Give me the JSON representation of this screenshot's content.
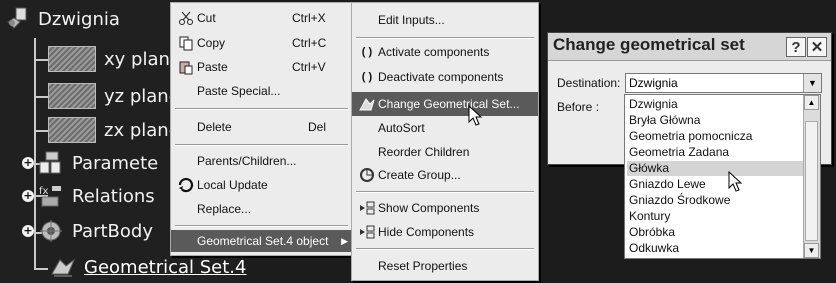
{
  "tree": {
    "root": "Dzwignia",
    "items": [
      {
        "label": "xy plane",
        "icon": "plane-icon"
      },
      {
        "label": "yz plane",
        "icon": "plane-icon"
      },
      {
        "label": "zx plane",
        "icon": "plane-icon"
      },
      {
        "label": "Paramete",
        "icon": "parameters-icon"
      },
      {
        "label": "Relations",
        "icon": "relations-icon"
      },
      {
        "label": "PartBody",
        "icon": "partbody-icon"
      },
      {
        "label": "Geometrical Set.4",
        "icon": "geometrical-set-icon"
      }
    ]
  },
  "context_menu": {
    "cut": {
      "label": "Cut",
      "key": "Ctrl+X"
    },
    "copy": {
      "label": "Copy",
      "key": "Ctrl+C"
    },
    "paste": {
      "label": "Paste",
      "key": "Ctrl+V"
    },
    "paste_special": "Paste Special...",
    "delete": {
      "label": "Delete",
      "key": "Del"
    },
    "parents_children": "Parents/Children...",
    "local_update": "Local Update",
    "replace": "Replace...",
    "object_submenu": "Geometrical Set.4 object"
  },
  "submenu": {
    "edit_inputs": "Edit Inputs...",
    "activate": "Activate components",
    "deactivate": "Deactivate components",
    "change_set": "Change Geometrical Set...",
    "autosort": "AutoSort",
    "reorder": "Reorder Children",
    "create_group": "Create Group...",
    "show": "Show Components",
    "hide": "Hide Components",
    "reset": "Reset Properties"
  },
  "dialog": {
    "title": "Change geometrical set",
    "help": "?",
    "close": "✕",
    "destination_label": "Destination:",
    "destination_value": "Dzwignia",
    "before_label": "Before :",
    "list": [
      "Dzwignia",
      "Bryła Główna",
      "Geometria pomocnicza",
      "Geometria Zadana",
      "Główka",
      "Gniazdo Lewe",
      "Gniazdo Środkowe",
      "Kontury",
      "Obróbka",
      "Odkuwka"
    ],
    "selected_index": 4
  },
  "colors": {
    "background": "#1c1c1c",
    "menu": "#ececec",
    "highlight": "#5a5a5a",
    "tree_text": "#f2f2f2"
  }
}
